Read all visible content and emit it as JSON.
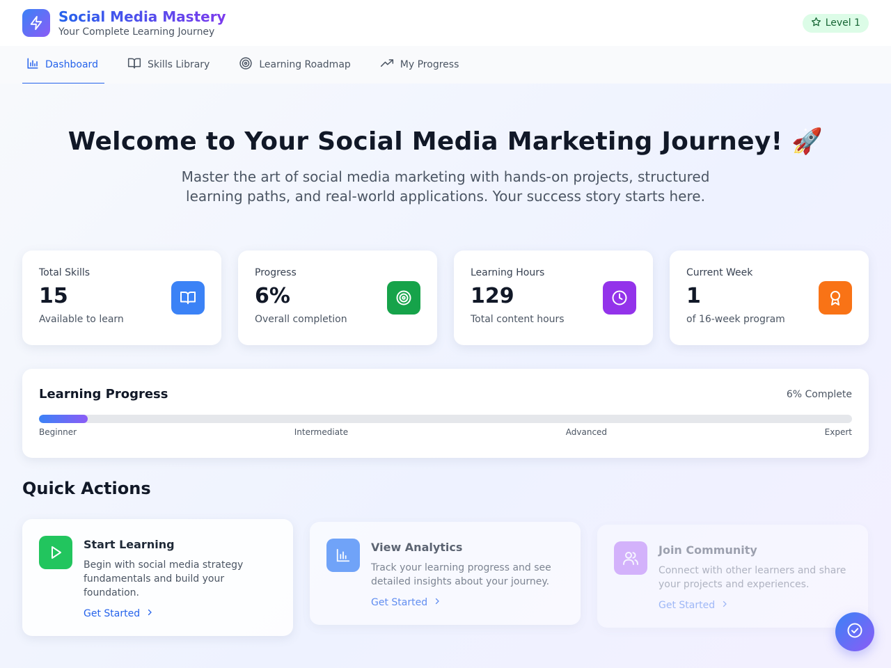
{
  "app": {
    "title": "Social Media Mastery",
    "subtitle": "Your Complete Learning Journey",
    "level_badge": "Level 1"
  },
  "nav": {
    "tabs": [
      {
        "label": "Dashboard",
        "icon": "bar-chart-icon",
        "active": true
      },
      {
        "label": "Skills Library",
        "icon": "book-open-icon",
        "active": false
      },
      {
        "label": "Learning Roadmap",
        "icon": "target-icon",
        "active": false
      },
      {
        "label": "My Progress",
        "icon": "trending-up-icon",
        "active": false
      }
    ]
  },
  "hero": {
    "title": "Welcome to Your Social Media Marketing Journey! 🚀",
    "description": "Master the art of social media marketing with hands-on projects, structured learning paths, and real-world applications. Your success story starts here."
  },
  "stats": [
    {
      "label": "Total Skills",
      "value": "15",
      "sub": "Available to learn",
      "icon": "book-open-icon",
      "color": "#3b82f6"
    },
    {
      "label": "Progress",
      "value": "6%",
      "sub": "Overall completion",
      "icon": "target-icon",
      "color": "#16a34a"
    },
    {
      "label": "Learning Hours",
      "value": "129",
      "sub": "Total content hours",
      "icon": "clock-icon",
      "color": "#9333ea"
    },
    {
      "label": "Current Week",
      "value": "1",
      "sub": "of 16-week program",
      "icon": "award-icon",
      "color": "#f97316"
    }
  ],
  "progress": {
    "title": "Learning Progress",
    "percent_label": "6% Complete",
    "percent": 6,
    "levels": [
      "Beginner",
      "Intermediate",
      "Advanced",
      "Expert"
    ]
  },
  "quick_actions": {
    "title": "Quick Actions",
    "items": [
      {
        "title": "Start Learning",
        "description": "Begin with social media strategy fundamentals and build your foundation.",
        "link": "Get Started",
        "icon": "play-icon",
        "color": "#22c55e"
      },
      {
        "title": "View Analytics",
        "description": "Track your learning progress and see detailed insights about your journey.",
        "link": "Get Started",
        "icon": "bar-chart-icon",
        "color": "#3b82f6"
      },
      {
        "title": "Join Community",
        "description": "Connect with other learners and share your projects and experiences.",
        "link": "Get Started",
        "icon": "users-icon",
        "color": "#a855f7"
      }
    ]
  },
  "colors": {
    "accent": "#2563eb",
    "brand_gradient_start": "#3b82f6",
    "brand_gradient_end": "#8b5cf6"
  }
}
